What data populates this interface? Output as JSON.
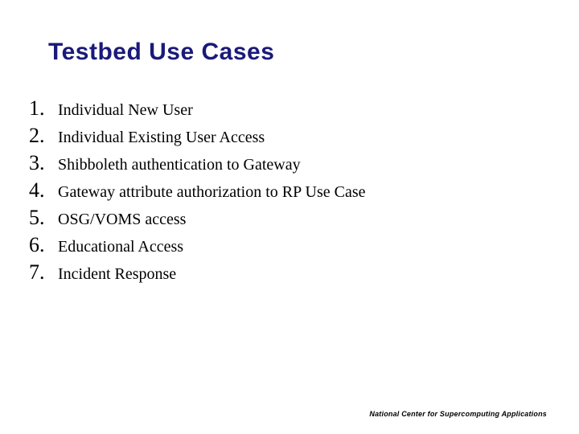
{
  "title": "Testbed Use Cases",
  "items": [
    {
      "n": "1.",
      "text": "Individual New User"
    },
    {
      "n": "2.",
      "text": "Individual Existing User Access"
    },
    {
      "n": "3.",
      "text": "Shibboleth authentication to Gateway"
    },
    {
      "n": "4.",
      "text": "Gateway attribute authorization to RP Use Case"
    },
    {
      "n": "5.",
      "text": "OSG/VOMS access"
    },
    {
      "n": "6.",
      "text": "Educational Access"
    },
    {
      "n": "7.",
      "text": "Incident Response"
    }
  ],
  "footer": "National Center for Supercomputing Applications"
}
